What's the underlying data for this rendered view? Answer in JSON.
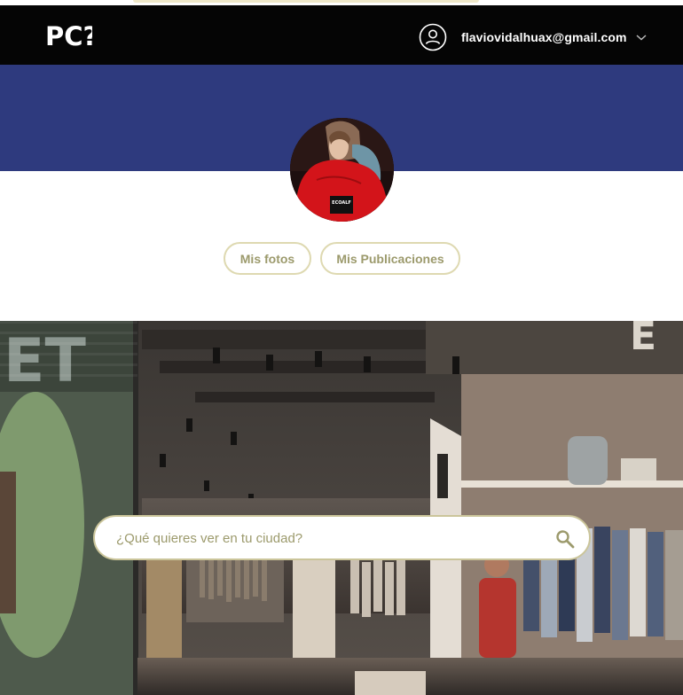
{
  "header": {
    "logo_text": "PC?",
    "user_email": "flaviovidalhuax@gmail.com",
    "user_icon": "user-circle-icon",
    "menu_icon": "chevron-down-icon"
  },
  "profile": {
    "cover_color": "#2e3a7e",
    "jacket_label": "ECOALF",
    "buttons": {
      "photos": "Mis fotos",
      "posts": "Mis Publicaciones"
    }
  },
  "search": {
    "placeholder": "¿Qué quieres ver en tu ciudad?",
    "value": "",
    "icon": "search-icon"
  },
  "colors": {
    "navbar": "#050505",
    "accent": "#9c9a6c",
    "pill_border": "#ded9b1"
  }
}
